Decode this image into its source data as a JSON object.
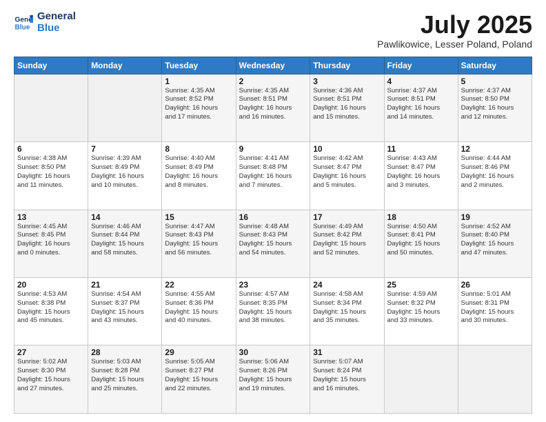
{
  "header": {
    "logo_line1": "General",
    "logo_line2": "Blue",
    "month": "July 2025",
    "location": "Pawlikowice, Lesser Poland, Poland"
  },
  "weekdays": [
    "Sunday",
    "Monday",
    "Tuesday",
    "Wednesday",
    "Thursday",
    "Friday",
    "Saturday"
  ],
  "weeks": [
    [
      {
        "day": "",
        "info": ""
      },
      {
        "day": "",
        "info": ""
      },
      {
        "day": "1",
        "info": "Sunrise: 4:35 AM\nSunset: 8:52 PM\nDaylight: 16 hours\nand 17 minutes."
      },
      {
        "day": "2",
        "info": "Sunrise: 4:35 AM\nSunset: 8:51 PM\nDaylight: 16 hours\nand 16 minutes."
      },
      {
        "day": "3",
        "info": "Sunrise: 4:36 AM\nSunset: 8:51 PM\nDaylight: 16 hours\nand 15 minutes."
      },
      {
        "day": "4",
        "info": "Sunrise: 4:37 AM\nSunset: 8:51 PM\nDaylight: 16 hours\nand 14 minutes."
      },
      {
        "day": "5",
        "info": "Sunrise: 4:37 AM\nSunset: 8:50 PM\nDaylight: 16 hours\nand 12 minutes."
      }
    ],
    [
      {
        "day": "6",
        "info": "Sunrise: 4:38 AM\nSunset: 8:50 PM\nDaylight: 16 hours\nand 11 minutes."
      },
      {
        "day": "7",
        "info": "Sunrise: 4:39 AM\nSunset: 8:49 PM\nDaylight: 16 hours\nand 10 minutes."
      },
      {
        "day": "8",
        "info": "Sunrise: 4:40 AM\nSunset: 8:49 PM\nDaylight: 16 hours\nand 8 minutes."
      },
      {
        "day": "9",
        "info": "Sunrise: 4:41 AM\nSunset: 8:48 PM\nDaylight: 16 hours\nand 7 minutes."
      },
      {
        "day": "10",
        "info": "Sunrise: 4:42 AM\nSunset: 8:47 PM\nDaylight: 16 hours\nand 5 minutes."
      },
      {
        "day": "11",
        "info": "Sunrise: 4:43 AM\nSunset: 8:47 PM\nDaylight: 16 hours\nand 3 minutes."
      },
      {
        "day": "12",
        "info": "Sunrise: 4:44 AM\nSunset: 8:46 PM\nDaylight: 16 hours\nand 2 minutes."
      }
    ],
    [
      {
        "day": "13",
        "info": "Sunrise: 4:45 AM\nSunset: 8:45 PM\nDaylight: 16 hours\nand 0 minutes."
      },
      {
        "day": "14",
        "info": "Sunrise: 4:46 AM\nSunset: 8:44 PM\nDaylight: 15 hours\nand 58 minutes."
      },
      {
        "day": "15",
        "info": "Sunrise: 4:47 AM\nSunset: 8:43 PM\nDaylight: 15 hours\nand 56 minutes."
      },
      {
        "day": "16",
        "info": "Sunrise: 4:48 AM\nSunset: 8:43 PM\nDaylight: 15 hours\nand 54 minutes."
      },
      {
        "day": "17",
        "info": "Sunrise: 4:49 AM\nSunset: 8:42 PM\nDaylight: 15 hours\nand 52 minutes."
      },
      {
        "day": "18",
        "info": "Sunrise: 4:50 AM\nSunset: 8:41 PM\nDaylight: 15 hours\nand 50 minutes."
      },
      {
        "day": "19",
        "info": "Sunrise: 4:52 AM\nSunset: 8:40 PM\nDaylight: 15 hours\nand 47 minutes."
      }
    ],
    [
      {
        "day": "20",
        "info": "Sunrise: 4:53 AM\nSunset: 8:38 PM\nDaylight: 15 hours\nand 45 minutes."
      },
      {
        "day": "21",
        "info": "Sunrise: 4:54 AM\nSunset: 8:37 PM\nDaylight: 15 hours\nand 43 minutes."
      },
      {
        "day": "22",
        "info": "Sunrise: 4:55 AM\nSunset: 8:36 PM\nDaylight: 15 hours\nand 40 minutes."
      },
      {
        "day": "23",
        "info": "Sunrise: 4:57 AM\nSunset: 8:35 PM\nDaylight: 15 hours\nand 38 minutes."
      },
      {
        "day": "24",
        "info": "Sunrise: 4:58 AM\nSunset: 8:34 PM\nDaylight: 15 hours\nand 35 minutes."
      },
      {
        "day": "25",
        "info": "Sunrise: 4:59 AM\nSunset: 8:32 PM\nDaylight: 15 hours\nand 33 minutes."
      },
      {
        "day": "26",
        "info": "Sunrise: 5:01 AM\nSunset: 8:31 PM\nDaylight: 15 hours\nand 30 minutes."
      }
    ],
    [
      {
        "day": "27",
        "info": "Sunrise: 5:02 AM\nSunset: 8:30 PM\nDaylight: 15 hours\nand 27 minutes."
      },
      {
        "day": "28",
        "info": "Sunrise: 5:03 AM\nSunset: 8:28 PM\nDaylight: 15 hours\nand 25 minutes."
      },
      {
        "day": "29",
        "info": "Sunrise: 5:05 AM\nSunset: 8:27 PM\nDaylight: 15 hours\nand 22 minutes."
      },
      {
        "day": "30",
        "info": "Sunrise: 5:06 AM\nSunset: 8:26 PM\nDaylight: 15 hours\nand 19 minutes."
      },
      {
        "day": "31",
        "info": "Sunrise: 5:07 AM\nSunset: 8:24 PM\nDaylight: 15 hours\nand 16 minutes."
      },
      {
        "day": "",
        "info": ""
      },
      {
        "day": "",
        "info": ""
      }
    ]
  ]
}
